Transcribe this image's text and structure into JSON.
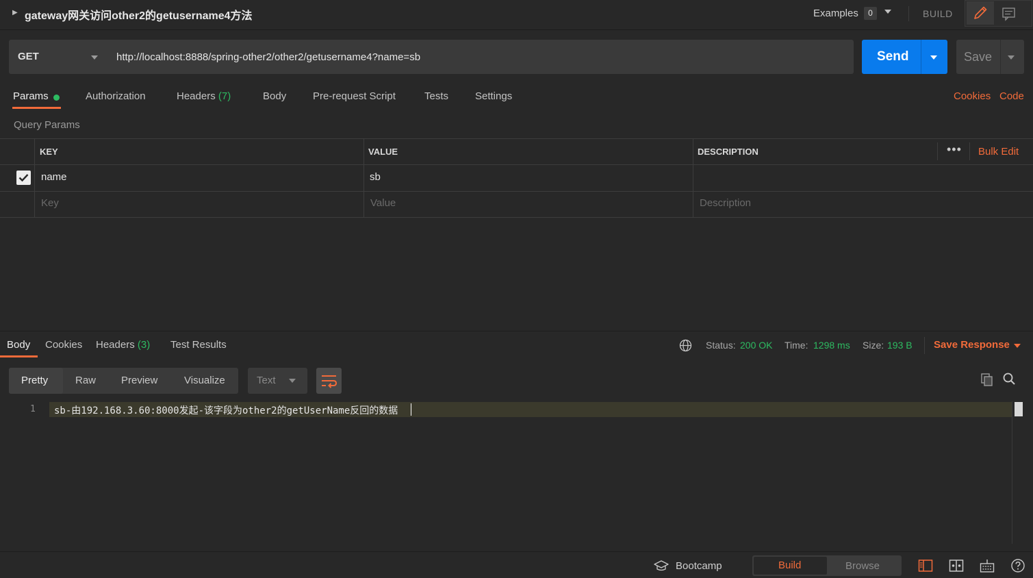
{
  "request": {
    "title": "gateway网关访问other2的getusername4方法",
    "examples_label": "Examples",
    "examples_count": "0",
    "build_label": "BUILD",
    "method": "GET",
    "url": "http://localhost:8888/spring-other2/other2/getusername4?name=sb",
    "send_label": "Send",
    "save_label": "Save"
  },
  "request_tabs": {
    "params": "Params",
    "authorization": "Authorization",
    "headers": "Headers",
    "headers_count": "(7)",
    "body": "Body",
    "prerequest": "Pre-request Script",
    "tests": "Tests",
    "settings": "Settings",
    "cookies": "Cookies",
    "code": "Code"
  },
  "query_params": {
    "title": "Query Params",
    "columns": [
      "KEY",
      "VALUE",
      "DESCRIPTION"
    ],
    "bulk_edit": "Bulk Edit",
    "rows": [
      {
        "key": "name",
        "value": "sb",
        "description": "",
        "checked": true
      }
    ],
    "placeholders": {
      "key": "Key",
      "value": "Value",
      "description": "Description"
    }
  },
  "response": {
    "tabs": {
      "body": "Body",
      "cookies": "Cookies",
      "headers": "Headers",
      "headers_count": "(3)",
      "test_results": "Test Results"
    },
    "status_label": "Status:",
    "status_value": "200 OK",
    "time_label": "Time:",
    "time_value": "1298 ms",
    "size_label": "Size:",
    "size_value": "193 B",
    "save_response": "Save Response",
    "formats": [
      "Pretty",
      "Raw",
      "Preview",
      "Visualize"
    ],
    "type_select": "Text",
    "line_number": "1",
    "body_text": "sb-由192.168.3.60:8000发起-该字段为other2的getUserName反回的数据"
  },
  "footer": {
    "bootcamp": "Bootcamp",
    "build": "Build",
    "browse": "Browse"
  },
  "colors": {
    "accent": "#f26b3a",
    "send": "#097bed",
    "success": "#2dbb61",
    "background": "#282828"
  }
}
